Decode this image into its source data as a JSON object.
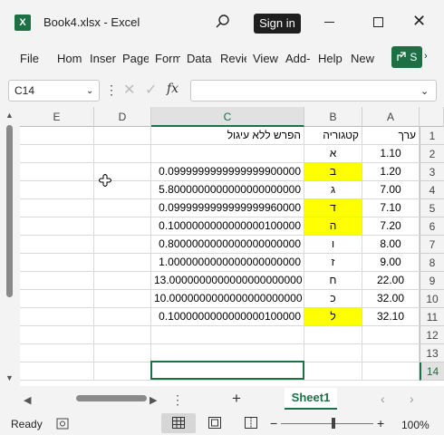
{
  "window": {
    "title": "Book4.xlsx  -  Excel",
    "signin": "Sign in",
    "app_logo": "X"
  },
  "ribbon": {
    "tabs": [
      "File",
      "Hom",
      "Inser",
      "Page",
      "Form",
      "Data",
      "Revie",
      "View",
      "Add-",
      "Help",
      "New"
    ],
    "share_label": "S"
  },
  "formula_bar": {
    "name_box": "C14",
    "formula": "",
    "fx_label": "fx"
  },
  "columns": [
    "A",
    "B",
    "C",
    "D",
    "E"
  ],
  "rows": [
    "1",
    "2",
    "3",
    "4",
    "5",
    "6",
    "7",
    "8",
    "9",
    "10",
    "11",
    "12",
    "13",
    "14"
  ],
  "headers": {
    "a": "ערך",
    "b": "קטגוריה",
    "c": "הפרש ללא עיגול"
  },
  "data": [
    {
      "a": "1.10",
      "b": "א",
      "c": "",
      "highlight": false
    },
    {
      "a": "1.20",
      "b": "ב",
      "c": "0.0999999999999999900000",
      "highlight": true
    },
    {
      "a": "7.00",
      "b": "ג",
      "c": "5.8000000000000000000000",
      "highlight": false
    },
    {
      "a": "7.10",
      "b": "ד",
      "c": "0.0999999999999999960000",
      "highlight": true
    },
    {
      "a": "7.20",
      "b": "ה",
      "c": "0.1000000000000000100000",
      "highlight": true
    },
    {
      "a": "8.00",
      "b": "ו",
      "c": "0.8000000000000000000000",
      "highlight": false
    },
    {
      "a": "9.00",
      "b": "ז",
      "c": "1.0000000000000000000000",
      "highlight": false
    },
    {
      "a": "22.00",
      "b": "ח",
      "c": "13.0000000000000000000000",
      "highlight": false
    },
    {
      "a": "32.00",
      "b": "כ",
      "c": "10.0000000000000000000000",
      "highlight": false
    },
    {
      "a": "32.10",
      "b": "ל",
      "c": "0.1000000000000000100000",
      "highlight": true
    }
  ],
  "sheet": {
    "active_tab": "Sheet1",
    "add_label": "+"
  },
  "status": {
    "ready": "Ready",
    "zoom": "100%"
  },
  "colors": {
    "accent": "#1d7044",
    "highlight": "#ffff00"
  }
}
